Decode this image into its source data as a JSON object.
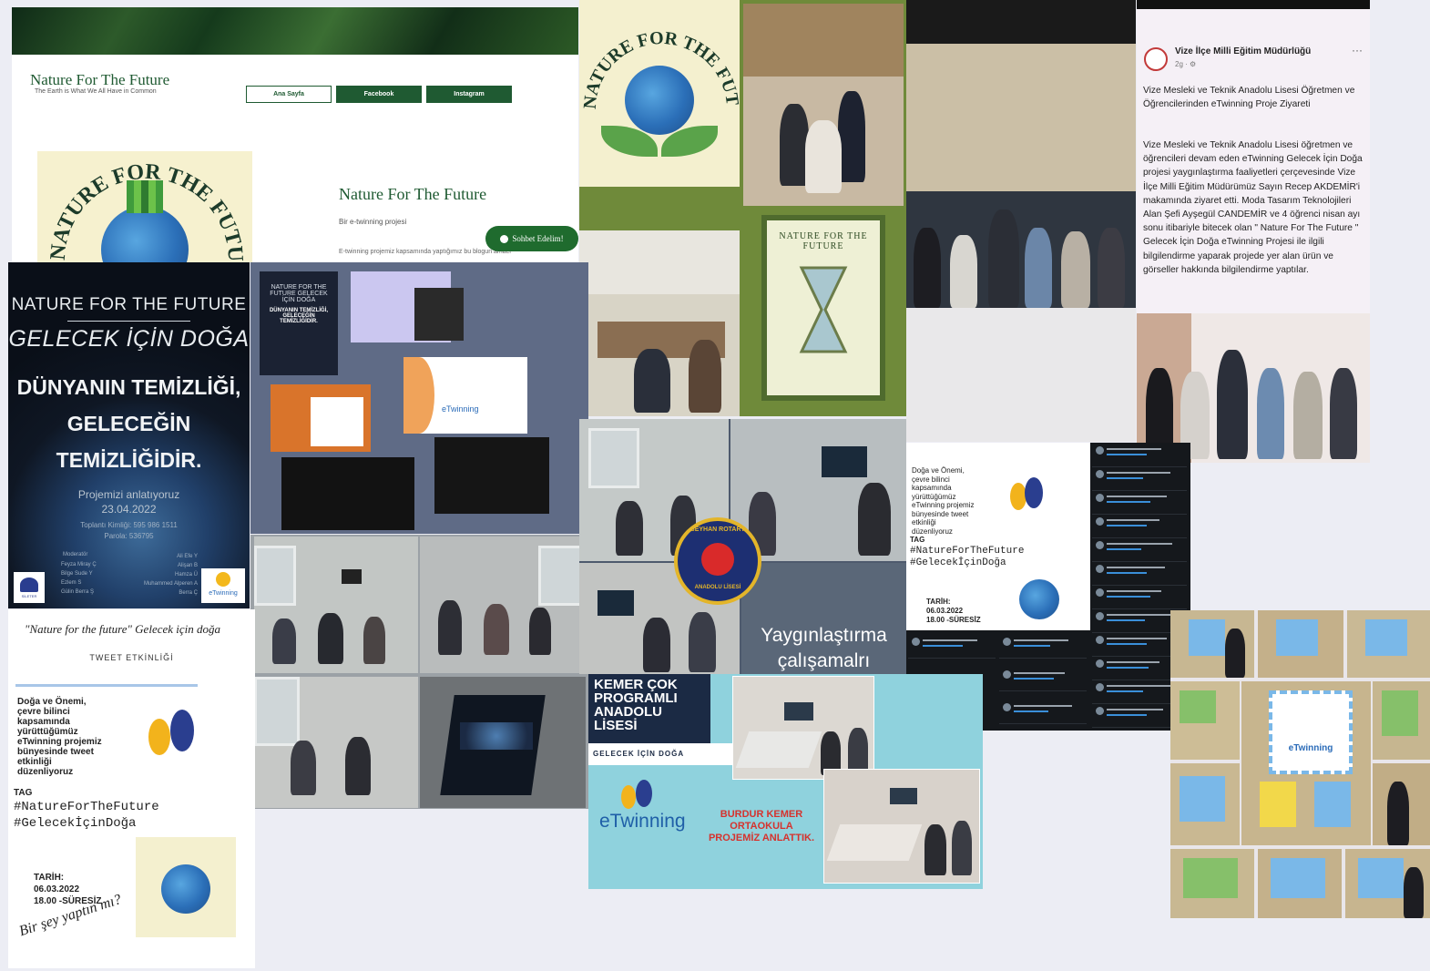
{
  "website": {
    "site_title": "Nature For The Future",
    "tagline": "The Earth is What We All Have in Common",
    "nav": [
      "Ana Sayfa",
      "Facebook",
      "Instagram"
    ],
    "heading": "Nature For The Future",
    "subheading": "Bir e-twinning projesi",
    "body": "E-twinning projemiz kapsamında yaptığımız bu blogun amacı",
    "chat_button": "Sohbet Edelim!",
    "logo_text": "NATURE FOR THE FUTURE"
  },
  "poster": {
    "line1": "NATURE FOR THE FUTURE",
    "line2": "GELECEK İÇİN DOĞA",
    "line3": "DÜNYANIN TEMİZLİĞİ,",
    "line4": "GELECEĞİN",
    "line5": "TEMİZLİĞİDİR.",
    "announce": "Projemizi anlatıyoruz",
    "date": "23.04.2022",
    "meeting_id": "Toplantı Kimliği: 595 986 1511",
    "password": "Parola: 536795",
    "moderators_label": "Moderatör",
    "names_left": [
      "Feyza Miray Ç",
      "Bilge Sude Y",
      "Ezlem S",
      "Gülin Berra Ş"
    ],
    "names_right": [
      "Ali Efe Y",
      "Alişan B",
      "Hamza Ü",
      "Muhammed Alperen A",
      "Berra Ç"
    ],
    "logo_left": "SİLETER",
    "logo_right": "eTwinning"
  },
  "meeting": {
    "slide_title": "NATURE FOR THE FUTURE GELECEK İÇİN DOĞA",
    "slide_text": "DÜNYANIN TEMİZLİĞİ, GELECEĞİN TEMİZLİĞİDİR.",
    "etw": "eTwinning"
  },
  "green_poster": {
    "logo_text": "NATURE FOR THE FUTURE",
    "hourglass_title": "NATURE FOR THE FUTURE"
  },
  "facebook": {
    "author": "Vize İlçe Milli Eğitim Müdürlüğü",
    "time": "2g · ⚙",
    "title": "Vize Mesleki ve Teknik Anadolu Lisesi Öğretmen ve Öğrencilerinden eTwinning Proje Ziyareti",
    "body": "Vize Mesleki ve Teknik Anadolu Lisesi öğretmen ve öğrencileri devam eden eTwinning Gelecek İçin Doğa projesi yaygınlaştırma faaliyetleri çerçevesinde Vize İlçe Milli Eğitim Müdürümüz Sayın Recep AKDEMİR'i makamında ziyaret etti. Moda Tasarım Teknolojileri Alan Şefi Ayşegül CANDEMİR ve 4 öğrenci nisan ayı sonu itibariyle bitecek olan \" Nature For The Future \" Gelecek İçin Doğa eTwinning Projesi ile ilgili bilgilendirme yaparak projede yer alan ürün ve görseller hakkında bilgilendirme yaptılar."
  },
  "tweet_small": {
    "lines": [
      "Doğa ve Önemi,",
      "çevre bilinci",
      "kapsamında",
      "yürüttüğümüz",
      "eTwinning projemiz",
      "bünyesinde tweet",
      "etkinliği",
      "düzenliyoruz"
    ],
    "tag_label": "TAG",
    "tag1": "#NatureForTheFuture",
    "tag2": "#GelecekİçinDoğa",
    "date_label": "TARİH:",
    "date": "06.03.2022",
    "time": "18.00 -SÜRESİZ"
  },
  "tweet_big": {
    "handwritten": "\"Nature for the future\" Gelecek için doğa",
    "event": "TWEET ETKİNLİĞİ",
    "lines": [
      "Doğa ve Önemi,",
      "çevre bilinci",
      "kapsamında",
      "yürüttüğümüz",
      "eTwinning projemiz",
      "bünyesinde tweet",
      "etkinliği",
      "düzenliyoruz"
    ],
    "tag_label": "TAG",
    "tag1": "#NatureForTheFuture",
    "tag2": "#GelecekİçinDoğa",
    "date_label": "TARİH:",
    "date": "06.03.2022",
    "time": "18.00 -SÜRESİZ",
    "question": "Bir şey yaptın mı?"
  },
  "seyhan": {
    "logo_top": "SEYHAN ROTARY",
    "logo_bottom": "ANADOLU LİSESİ",
    "caption_1": "Yaygınlaştırma",
    "caption_2": "çalışamalrı"
  },
  "kemer": {
    "school": "KEMER ÇOK PROGRAMLI ANADOLU LİSESİ",
    "sub": "GELECEK İÇİN DOĞA",
    "etw": "eTwinning",
    "red_text": "BURDUR KEMER ORTAOKULA PROJEMİZ ANLATTIK."
  },
  "board": {
    "label": "eTwinning"
  },
  "colors": {
    "forest": "#1f5a32",
    "poster_bg": "#1b2230",
    "slate": "#5f6b86",
    "olive": "#6f8a3a",
    "kemer_teal": "#8fd2dd",
    "navy": "#1b2a44"
  }
}
